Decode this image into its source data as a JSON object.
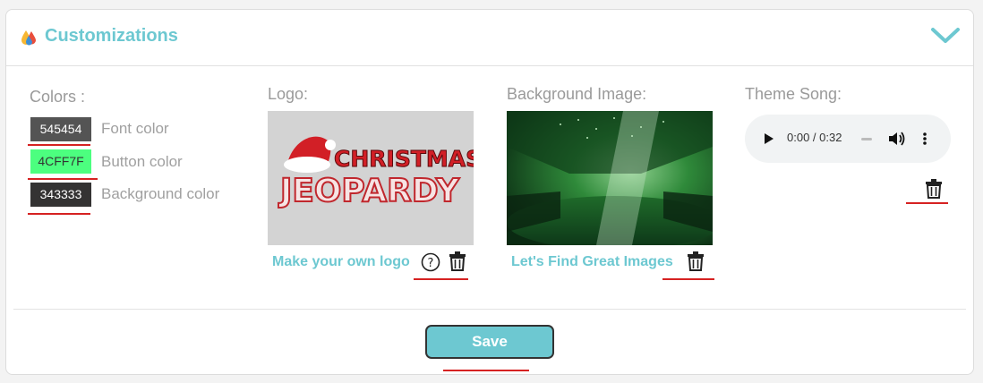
{
  "header": {
    "title": "Customizations",
    "title_color": "#6dc8d1"
  },
  "colors": {
    "label": "Colors :",
    "items": [
      {
        "value": "545454",
        "label": "Font color",
        "swatch": "#545454",
        "text_color": "#ffffff"
      },
      {
        "value": "4CFF7F",
        "label": "Button color",
        "swatch": "#4cff7f",
        "text_color": "#333333"
      },
      {
        "value": "343333",
        "label": "Background color",
        "swatch": "#343333",
        "text_color": "#ffffff"
      }
    ]
  },
  "logo": {
    "label": "Logo:",
    "image_text_top": "CHRISTMAS",
    "image_text_bottom": "JEOPARDY",
    "link": "Make your own logo",
    "help_icon": "question-circle-icon",
    "delete_icon": "trash-icon"
  },
  "background": {
    "label": "Background Image:",
    "link": "Let's Find Great Images",
    "delete_icon": "trash-icon"
  },
  "theme_song": {
    "label": "Theme Song:",
    "time": "0:00 / 0:32",
    "delete_icon": "trash-icon"
  },
  "footer": {
    "save_label": "Save"
  },
  "accent_red": "#d62222"
}
